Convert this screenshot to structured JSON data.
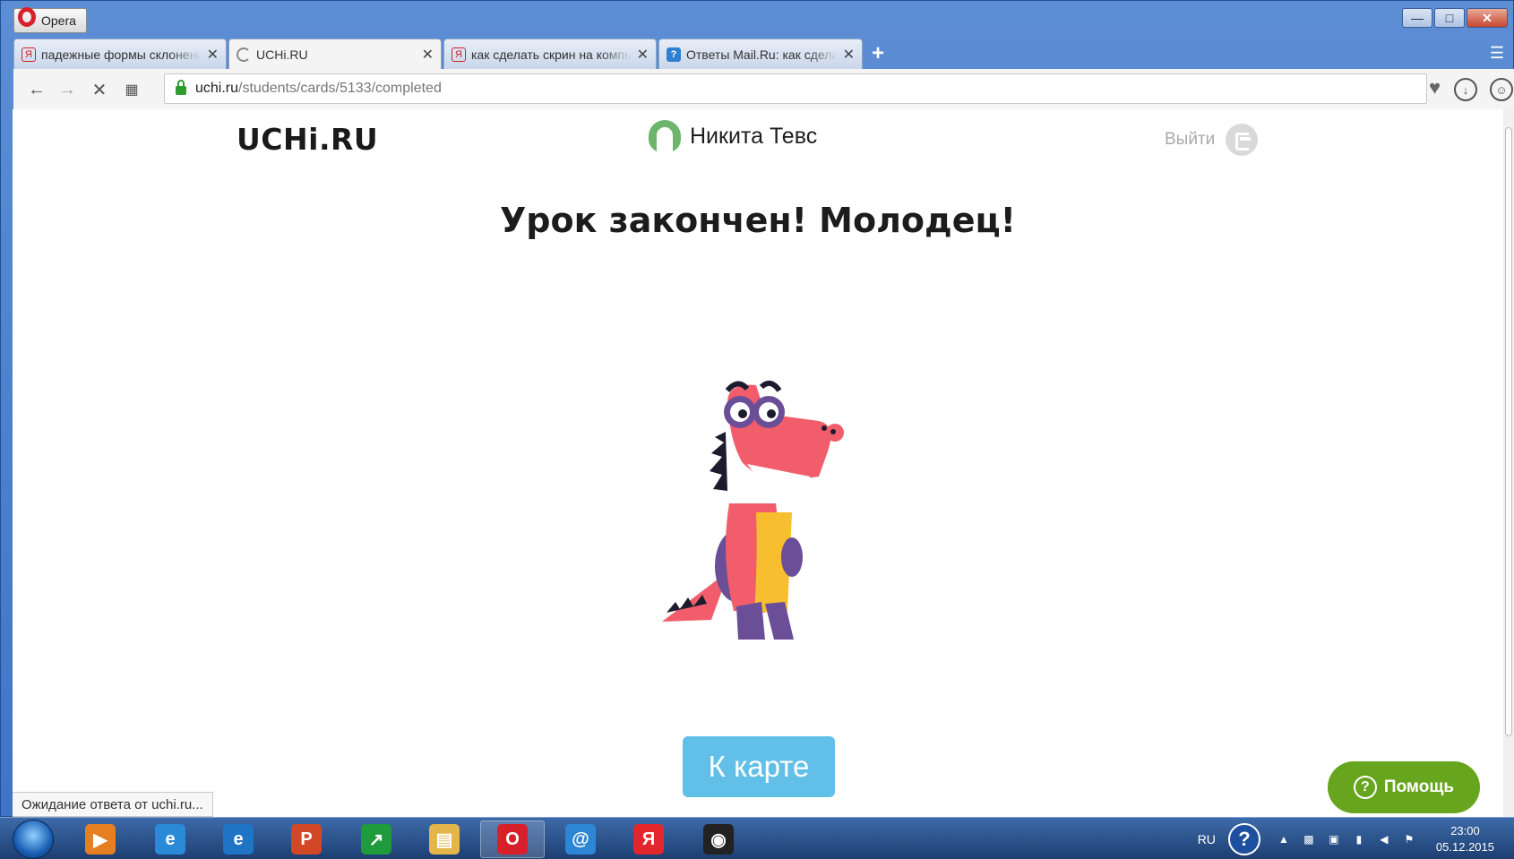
{
  "browser": {
    "menu_label": "Opera",
    "tabs": [
      {
        "icon": "yandex-icon",
        "title": "падежные формы склонения",
        "active": false
      },
      {
        "icon": "loading-icon",
        "title": "UCHi.RU",
        "active": true
      },
      {
        "icon": "yandex-icon",
        "title": "как сделать скрин на компьютере",
        "active": false
      },
      {
        "icon": "question-icon",
        "title": "Ответы Mail.Ru: как сделать",
        "active": false
      }
    ],
    "url_host": "uchi.ru",
    "url_path": "/students/cards/5133/completed"
  },
  "page": {
    "logo": "UCHi.RU",
    "user_name": "Никита Тевс",
    "logout_label": "Выйти",
    "heading": "Урок закончен! Молодец!",
    "map_button": "К карте",
    "help_button": "Помощь",
    "status_text": "Ожидание ответа от uchi.ru..."
  },
  "taskbar": {
    "apps": [
      {
        "name": "media-player-icon",
        "label": "▶",
        "color": "#e67e22"
      },
      {
        "name": "ie-taskbar-icon",
        "label": "e",
        "color": "#2a8ad8"
      },
      {
        "name": "ie-icon",
        "label": "e",
        "color": "#1f74c6"
      },
      {
        "name": "powerpoint-icon",
        "label": "P",
        "color": "#d24726"
      },
      {
        "name": "stocks-icon",
        "label": "↗",
        "color": "#1f9b3b"
      },
      {
        "name": "file-explorer-icon",
        "label": "▤",
        "color": "#e3b54a"
      },
      {
        "name": "opera-taskbar-icon",
        "label": "O",
        "color": "#d8202a"
      },
      {
        "name": "mail-agent-icon",
        "label": "@",
        "color": "#2d86d4"
      },
      {
        "name": "yandex-browser-icon",
        "label": "Я",
        "color": "#e3262b"
      },
      {
        "name": "app-icon",
        "label": "◉",
        "color": "#222222"
      }
    ],
    "language": "RU",
    "time": "23:00",
    "date": "05.12.2015"
  }
}
